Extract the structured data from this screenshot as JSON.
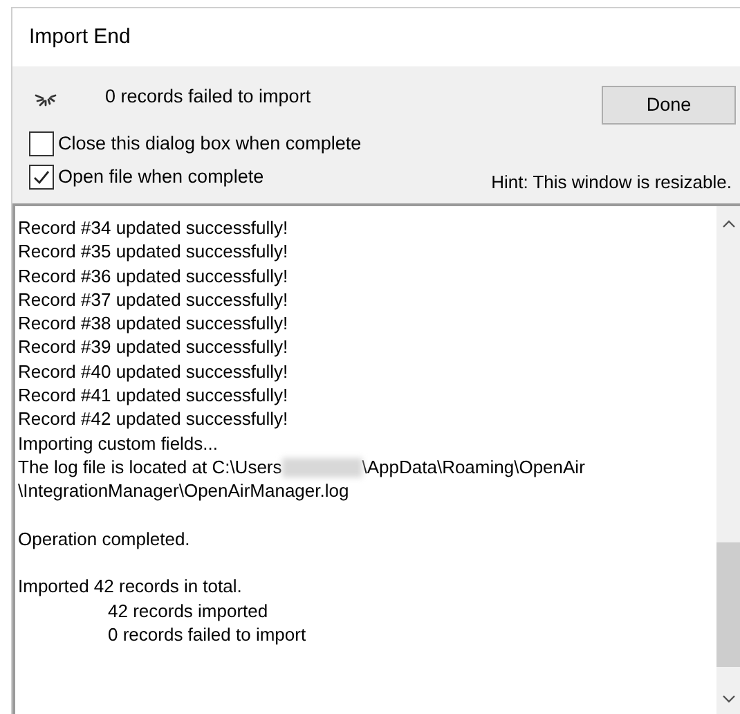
{
  "window": {
    "title": "Import End"
  },
  "status": {
    "message": "0 records failed to import"
  },
  "done_button": {
    "label": "Done"
  },
  "options": [
    {
      "label": "Close this dialog box when complete",
      "checked": false
    },
    {
      "label": "Open file when complete",
      "checked": true
    }
  ],
  "hint": "Hint: This window is resizable.",
  "log": [
    {
      "kind": "line",
      "text": "Record #34 updated successfully!"
    },
    {
      "kind": "line",
      "text": "Record #35 updated successfully!"
    },
    {
      "kind": "line",
      "text": "Record #36 updated successfully!"
    },
    {
      "kind": "line",
      "text": "Record #37 updated successfully!"
    },
    {
      "kind": "line",
      "text": "Record #38 updated successfully!"
    },
    {
      "kind": "line",
      "text": "Record #39 updated successfully!"
    },
    {
      "kind": "line",
      "text": "Record #40 updated successfully!"
    },
    {
      "kind": "line",
      "text": "Record #41 updated successfully!"
    },
    {
      "kind": "line",
      "text": "Record #42 updated successfully!"
    },
    {
      "kind": "line",
      "text": "Importing custom fields..."
    },
    {
      "kind": "redacted",
      "before": "The log file is located at C:\\Users",
      "after": "\\AppData\\Roaming\\OpenAir"
    },
    {
      "kind": "line",
      "text": "\\IntegrationManager\\OpenAirManager.log"
    },
    {
      "kind": "gap"
    },
    {
      "kind": "line",
      "text": "Operation completed."
    },
    {
      "kind": "gap"
    },
    {
      "kind": "line",
      "text": "Imported 42 records in total."
    },
    {
      "kind": "indented",
      "text": "42 records imported"
    },
    {
      "kind": "indented",
      "text": "0 records failed to import"
    }
  ]
}
